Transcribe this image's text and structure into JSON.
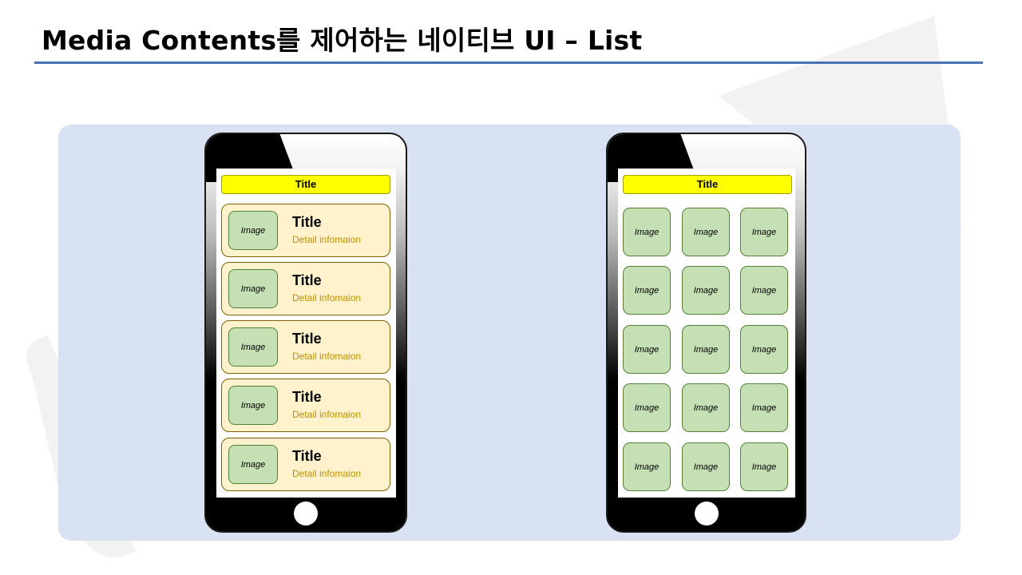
{
  "slide": {
    "title": "Media Contents를 제어하는 네이티브 UI – List"
  },
  "list_phone": {
    "app_bar_title": "Title",
    "items": [
      {
        "image": "Image",
        "title": "Title",
        "detail": "Detail infomaion"
      },
      {
        "image": "Image",
        "title": "Title",
        "detail": "Detail infomaion"
      },
      {
        "image": "Image",
        "title": "Title",
        "detail": "Detail infomaion"
      },
      {
        "image": "Image",
        "title": "Title",
        "detail": "Detail infomaion"
      },
      {
        "image": "Image",
        "title": "Title",
        "detail": "Detail infomaion"
      }
    ]
  },
  "grid_phone": {
    "app_bar_title": "Title",
    "tiles": [
      {
        "label": "Image"
      },
      {
        "label": "Image"
      },
      {
        "label": "Image"
      },
      {
        "label": "Image"
      },
      {
        "label": "Image"
      },
      {
        "label": "Image"
      },
      {
        "label": "Image"
      },
      {
        "label": "Image"
      },
      {
        "label": "Image"
      },
      {
        "label": "Image"
      },
      {
        "label": "Image"
      },
      {
        "label": "Image"
      },
      {
        "label": "Image"
      },
      {
        "label": "Image"
      },
      {
        "label": "Image"
      }
    ]
  },
  "colors": {
    "title_rule": "#4a72b2",
    "panel_bg": "#d9e2f3",
    "app_bar": "#ffff00",
    "list_item_bg": "#fff2cc",
    "image_placeholder": "#c5e0b4",
    "detail_text": "#bf9000"
  }
}
